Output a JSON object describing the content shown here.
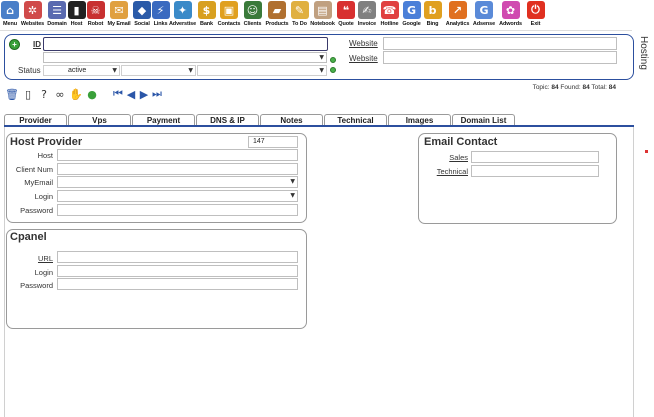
{
  "toolbar": {
    "items": [
      {
        "label": "Menu",
        "icon": "home-icon",
        "glyph": "⌂",
        "color": "#4a7fc8"
      },
      {
        "label": "Websites",
        "icon": "websites-icon",
        "glyph": "✲",
        "color": "#d04a4a"
      },
      {
        "label": "Domain",
        "icon": "domain-icon",
        "glyph": "☰",
        "color": "#5a6ab0"
      },
      {
        "label": "Host",
        "icon": "host-icon",
        "glyph": "▮",
        "color": "#222222"
      },
      {
        "label": "Robot",
        "icon": "robot-icon",
        "glyph": "☠",
        "color": "#c83030"
      },
      {
        "label": "My Email",
        "icon": "email-icon",
        "glyph": "✉",
        "color": "#e0a040"
      },
      {
        "label": "Social",
        "icon": "social-icon",
        "glyph": "◆",
        "color": "#2a5aa8"
      },
      {
        "label": "Links",
        "icon": "links-icon",
        "glyph": "⚡",
        "color": "#3a6ac0"
      },
      {
        "label": "Adverstise",
        "icon": "advertise-icon",
        "glyph": "✦",
        "color": "#3a8ac8"
      },
      {
        "label": "Bank",
        "icon": "bank-icon",
        "glyph": "$",
        "color": "#d8a020"
      },
      {
        "label": "Contacts",
        "icon": "contacts-icon",
        "glyph": "▣",
        "color": "#e0a020"
      },
      {
        "label": "Clients",
        "icon": "clients-icon",
        "glyph": "☺",
        "color": "#3a7a3a"
      },
      {
        "label": "Products",
        "icon": "products-icon",
        "glyph": "▰",
        "color": "#b07030"
      },
      {
        "label": "To Do",
        "icon": "todo-icon",
        "glyph": "✎",
        "color": "#e0b040"
      },
      {
        "label": "Notebook",
        "icon": "notebook-icon",
        "glyph": "▤",
        "color": "#c0a080"
      },
      {
        "label": "Quote",
        "icon": "quote-icon",
        "glyph": "❝",
        "color": "#d83030"
      },
      {
        "label": "Invoice",
        "icon": "invoice-icon",
        "glyph": "✍",
        "color": "#808080"
      },
      {
        "label": "Hotline",
        "icon": "hotline-icon",
        "glyph": "☎",
        "color": "#e04040"
      },
      {
        "label": "Google",
        "icon": "google-icon",
        "glyph": "G",
        "color": "#4a7fd8"
      },
      {
        "label": "Bing",
        "icon": "bing-icon",
        "glyph": "b",
        "color": "#e0a020"
      },
      {
        "label": "Analytics",
        "icon": "analytics-icon",
        "glyph": "↗",
        "color": "#e07020"
      },
      {
        "label": "Adsense",
        "icon": "adsense-icon",
        "glyph": "G",
        "color": "#5a8ad8"
      },
      {
        "label": "Adwords",
        "icon": "adwords-icon",
        "glyph": "✿",
        "color": "#d04ab0"
      },
      {
        "label": "Exit",
        "icon": "power-icon",
        "glyph": "⏻",
        "color": "#e03020"
      }
    ]
  },
  "window_title": "Hosting",
  "search": {
    "id_label": "ID",
    "id_value": "",
    "status_label": "Status",
    "status_value": "active",
    "select2_value": "",
    "select3_value": "",
    "select4_value": "",
    "website1_label": "Website",
    "website1_value": "",
    "website2_label": "Website",
    "website2_value": ""
  },
  "counts": {
    "topic_label": "Topic:",
    "topic_value": "84",
    "found_label": "Found:",
    "found_value": "84",
    "total_label": "Total:",
    "total_value": "84"
  },
  "tabs": [
    "Provider",
    "Vps",
    "Payment",
    "DNS & IP",
    "Notes",
    "Technical",
    "Images",
    "Domain List"
  ],
  "host_provider": {
    "title": "Host Provider",
    "id_value": "147",
    "host_label": "Host",
    "client_num_label": "Client Num",
    "myemail_label": "MyEmail",
    "login_label": "Login",
    "password_label": "Password",
    "host_value": "",
    "client_num_value": "",
    "myemail_value": "",
    "login_value": "",
    "password_value": ""
  },
  "cpanel": {
    "title": "Cpanel",
    "url_label": "URL",
    "login_label": "Login",
    "password_label": "Password",
    "url_value": "",
    "login_value": "",
    "password_value": ""
  },
  "email_contact": {
    "title": "Email Contact",
    "sales_label": "Sales",
    "technical_label": "Technical",
    "sales_value": "",
    "technical_value": ""
  }
}
